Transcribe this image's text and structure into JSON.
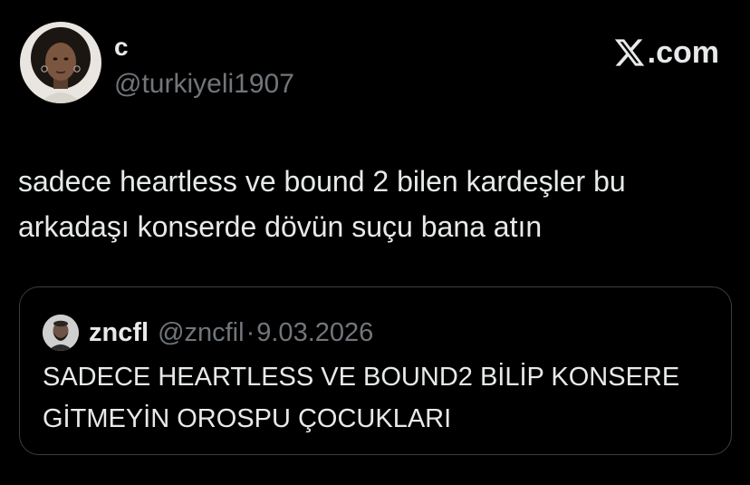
{
  "brand": {
    "icon": "x-logo-icon",
    "suffix": ".com"
  },
  "tweet": {
    "author": {
      "display_name": "c",
      "handle": "@turkiyeli1907"
    },
    "text": "sadece heartless ve bound 2 bilen kardeşler bu arkadaşı konserde dövün suçu bana atın",
    "quoted": {
      "author": {
        "display_name": "zncfl",
        "handle": "@zncfil"
      },
      "separator": "·",
      "date": "9.03.2026",
      "text": "SADECE HEARTLESS VE BOUND2 BİLİP KONSERE GİTMEYİN OROSPU ÇOCUKLARI"
    }
  },
  "colors": {
    "background": "#000000",
    "text": "#e7e9ea",
    "secondary": "#71767b",
    "border": "#3a3d41"
  }
}
